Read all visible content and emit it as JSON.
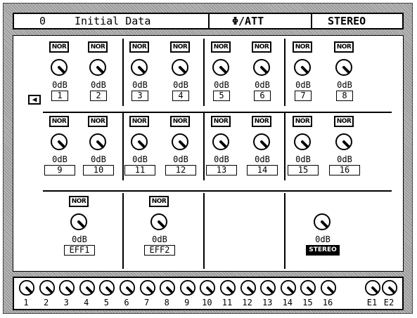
{
  "title": {
    "scene_number": "0",
    "scene_name": "Initial Data",
    "function": "Φ/ATT",
    "stereo": "STEREO"
  },
  "channels": [
    {
      "id": "1",
      "phase": "NOR",
      "att": "0dB",
      "label": "1"
    },
    {
      "id": "2",
      "phase": "NOR",
      "att": "0dB",
      "label": "2"
    },
    {
      "id": "3",
      "phase": "NOR",
      "att": "0dB",
      "label": "3"
    },
    {
      "id": "4",
      "phase": "NOR",
      "att": "0dB",
      "label": "4"
    },
    {
      "id": "5",
      "phase": "NOR",
      "att": "0dB",
      "label": "5"
    },
    {
      "id": "6",
      "phase": "NOR",
      "att": "0dB",
      "label": "6"
    },
    {
      "id": "7",
      "phase": "NOR",
      "att": "0dB",
      "label": "7"
    },
    {
      "id": "8",
      "phase": "NOR",
      "att": "0dB",
      "label": "8"
    },
    {
      "id": "9",
      "phase": "NOR",
      "att": "0dB",
      "label": "9"
    },
    {
      "id": "10",
      "phase": "NOR",
      "att": "0dB",
      "label": "10"
    },
    {
      "id": "11",
      "phase": "NOR",
      "att": "0dB",
      "label": "11"
    },
    {
      "id": "12",
      "phase": "NOR",
      "att": "0dB",
      "label": "12"
    },
    {
      "id": "13",
      "phase": "NOR",
      "att": "0dB",
      "label": "13"
    },
    {
      "id": "14",
      "phase": "NOR",
      "att": "0dB",
      "label": "14"
    },
    {
      "id": "15",
      "phase": "NOR",
      "att": "0dB",
      "label": "15"
    },
    {
      "id": "16",
      "phase": "NOR",
      "att": "0dB",
      "label": "16"
    }
  ],
  "effects": [
    {
      "id": "eff1",
      "phase": "NOR",
      "att": "0dB",
      "label": "EFF1"
    },
    {
      "id": "eff2",
      "phase": "NOR",
      "att": "0dB",
      "label": "EFF2"
    }
  ],
  "stereo_out": {
    "att": "0dB",
    "label": "STEREO"
  },
  "bottom_knobs": [
    "1",
    "2",
    "3",
    "4",
    "5",
    "6",
    "7",
    "8",
    "9",
    "10",
    "11",
    "12",
    "13",
    "14",
    "15",
    "16",
    "E1",
    "E2"
  ]
}
